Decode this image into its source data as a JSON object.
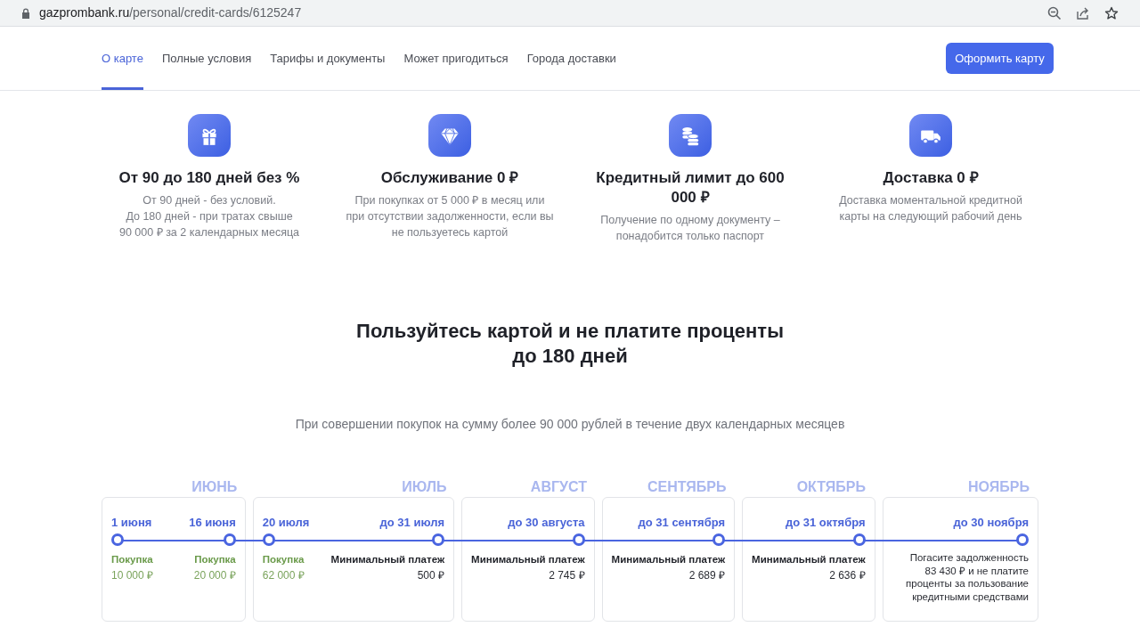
{
  "browser": {
    "url_host": "gazprombank.ru",
    "url_path": "/personal/credit-cards/6125247"
  },
  "nav": {
    "tabs": [
      {
        "label": "О карте",
        "selected": true
      },
      {
        "label": "Полные условия",
        "selected": false
      },
      {
        "label": "Тарифы и документы",
        "selected": false
      },
      {
        "label": "Может пригодиться",
        "selected": false
      },
      {
        "label": "Города доставки",
        "selected": false
      }
    ],
    "button": "Оформить карту"
  },
  "features": [
    {
      "title_lines": [
        "От 90 до 180 дней без %"
      ],
      "description_lines": [
        "От 90 дней - без условий.",
        "До 180 дней - при тратах свыше",
        "90 000 ₽ за 2 календарных месяца"
      ]
    },
    {
      "title_lines": [
        "Обслуживание 0 ₽"
      ],
      "description_lines": [
        "При покупках от 5 000 ₽ в месяц или",
        "при отсутствии задолженности, если вы",
        "не пользуетесь картой"
      ]
    },
    {
      "title_lines": [
        "Кредитный лимит до 600",
        "000 ₽"
      ],
      "description_lines": [
        "Получение по одному документу –",
        "понадобится только паспорт"
      ]
    },
    {
      "title_lines": [
        "Доставка 0 ₽"
      ],
      "description_lines": [
        "Доставка моментальной кредитной",
        "карты на следующий рабочий день"
      ]
    }
  ],
  "promo": {
    "title_lines": [
      "Пользуйтесь картой и не платите проценты",
      "до 180 дней"
    ],
    "subtitle": "При совершении покупок на сумму более 90 000 рублей в течение двух календарных месяцев"
  },
  "timeline": [
    {
      "month": "ИЮНЬ",
      "events": [
        {
          "date": "1 июня",
          "kind": "purchase",
          "label": "Покупка",
          "amount": "10 000 ₽"
        },
        {
          "date": "16 июня",
          "kind": "purchase",
          "label": "Покупка",
          "amount": "20 000 ₽"
        }
      ]
    },
    {
      "month": "ИЮЛЬ",
      "events": [
        {
          "date": "20 июля",
          "kind": "purchase",
          "label": "Покупка",
          "amount": "62 000 ₽"
        },
        {
          "date": "до 31 июля",
          "kind": "payment",
          "label": "Минимальный платеж",
          "amount": "500 ₽"
        }
      ]
    },
    {
      "month": "АВГУСТ",
      "events": [
        {
          "date": "до 30 августа",
          "kind": "payment",
          "label": "Минимальный платеж",
          "amount": "2 745 ₽"
        }
      ]
    },
    {
      "month": "СЕНТЯБРЬ",
      "events": [
        {
          "date": "до 31 сентября",
          "kind": "payment",
          "label": "Минимальный платеж",
          "amount": "2 689 ₽"
        }
      ]
    },
    {
      "month": "ОКТЯБРЬ",
      "events": [
        {
          "date": "до 31 октября",
          "kind": "payment",
          "label": "Минимальный платеж",
          "amount": "2 636 ₽"
        }
      ]
    },
    {
      "month": "НОЯБРЬ",
      "events": [
        {
          "date": "до 30 ноября",
          "kind": "final",
          "text_lines": [
            "Погасите задолженность",
            "83 430 ₽ и не платите",
            "проценты за пользование",
            "кредитными средствами"
          ]
        }
      ]
    }
  ]
}
